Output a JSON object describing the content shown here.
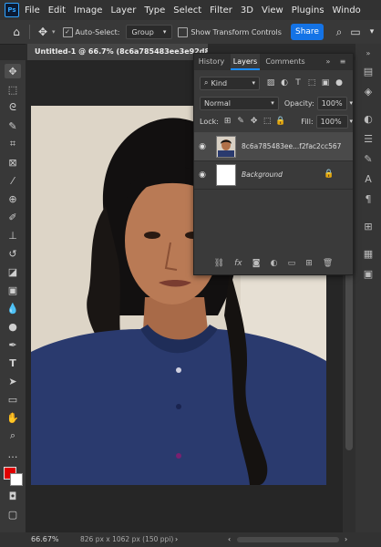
{
  "menubar": {
    "logo": "Ps",
    "items": [
      "File",
      "Edit",
      "Image",
      "Layer",
      "Type",
      "Select",
      "Filter",
      "3D",
      "View",
      "Plugins",
      "Windo"
    ]
  },
  "options": {
    "auto_select_label": "Auto-Select:",
    "auto_select_value": "Group",
    "transform_label": "Show Transform Controls",
    "share_label": "Share"
  },
  "document": {
    "tab_title": "Untitled-1 @ 66.7% (8c6a785483ee3e92d816"
  },
  "status": {
    "zoom": "66.67%",
    "info": "826 px x 1062 px (150 ppi)"
  },
  "layers_panel": {
    "tabs": [
      "History",
      "Layers",
      "Comments"
    ],
    "active_tab": "Layers",
    "filter_value": "Kind",
    "blend_mode": "Normal",
    "opacity_label": "Opacity:",
    "opacity_value": "100%",
    "lock_label": "Lock:",
    "fill_label": "Fill:",
    "fill_value": "100%",
    "layers": [
      {
        "name": "8c6a785483ee...f2fac2cc567",
        "selected": true
      },
      {
        "name": "Background",
        "selected": false
      }
    ]
  },
  "colors": {
    "accent": "#1473e6",
    "foreground_swatch": "#e00000",
    "background_swatch": "#ffffff"
  }
}
